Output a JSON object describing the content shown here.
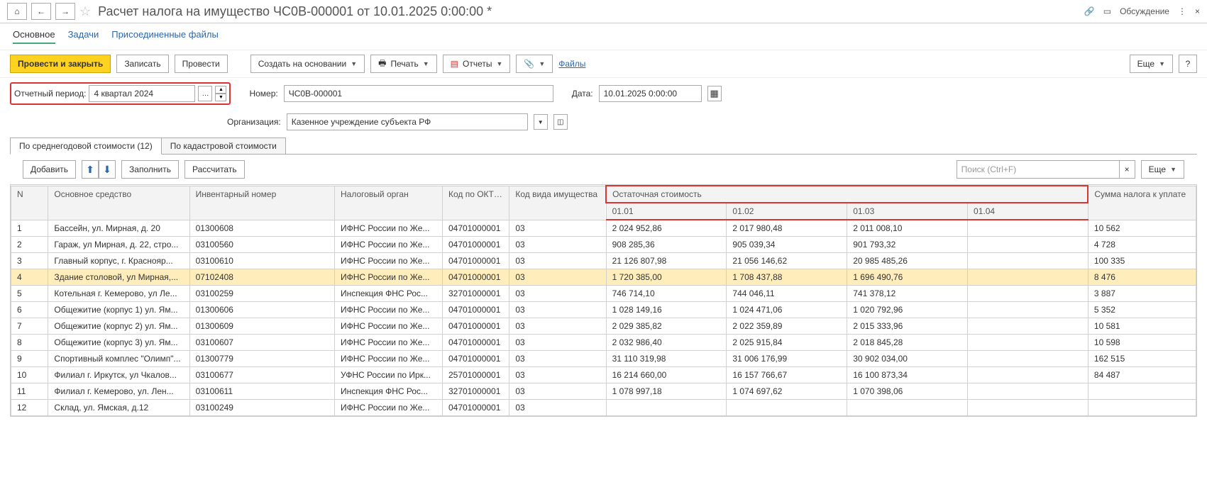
{
  "header": {
    "title": "Расчет налога на имущество ЧС0В-000001 от 10.01.2025 0:00:00 *",
    "discussion": "Обсуждение"
  },
  "nav_tabs": {
    "main": "Основное",
    "tasks": "Задачи",
    "files": "Присоединенные файлы"
  },
  "toolbar": {
    "post_close": "Провести и закрыть",
    "write": "Записать",
    "post": "Провести",
    "create_based": "Создать на основании",
    "print": "Печать",
    "reports": "Отчеты",
    "files": "Файлы",
    "more": "Еще"
  },
  "form": {
    "period_label": "Отчетный период:",
    "period_value": "4 квартал 2024",
    "number_label": "Номер:",
    "number_value": "ЧС0В-000001",
    "date_label": "Дата:",
    "date_value": "10.01.2025  0:00:00",
    "org_label": "Организация:",
    "org_value": "Казенное учреждение субъекта РФ"
  },
  "subtabs": {
    "avg": "По среднегодовой стоимости (12)",
    "cadastr": "По кадастровой стоимости"
  },
  "subtoolbar": {
    "add": "Добавить",
    "fill": "Заполнить",
    "calc": "Рассчитать",
    "search_placeholder": "Поиск (Ctrl+F)",
    "more": "Еще"
  },
  "grid": {
    "headers": {
      "n": "N",
      "asset": "Основное средство",
      "inv": "Инвентарный номер",
      "tax_org": "Налоговый орган",
      "oktmo": "Код по ОКТМО",
      "kind": "Код вида имущества",
      "residual": "Остаточная стоимость",
      "d01": "01.01",
      "d02": "01.02",
      "d03": "01.03",
      "d04": "01.04",
      "sum": "Сумма налога к уплате"
    },
    "rows": [
      {
        "n": "1",
        "asset": "Бассейн, ул. Мирная, д. 20",
        "inv": "01300608",
        "tax_org": "ИФНС России по Же...",
        "oktmo": "04701000001",
        "kind": "03",
        "v1": "2 024 952,86",
        "v2": "2 017 980,48",
        "v3": "2 011 008,10",
        "v4": "",
        "sum": "10 562"
      },
      {
        "n": "2",
        "asset": "Гараж, ул Мирная, д. 22, стро...",
        "inv": "03100560",
        "tax_org": "ИФНС России по Же...",
        "oktmo": "04701000001",
        "kind": "03",
        "v1": "908 285,36",
        "v2": "905 039,34",
        "v3": "901 793,32",
        "v4": "",
        "sum": "4 728"
      },
      {
        "n": "3",
        "asset": "Главный корпус, г. Краснояр...",
        "inv": "03100610",
        "tax_org": "ИФНС России по Же...",
        "oktmo": "04701000001",
        "kind": "03",
        "v1": "21 126 807,98",
        "v2": "21 056 146,62",
        "v3": "20 985 485,26",
        "v4": "",
        "sum": "100 335"
      },
      {
        "n": "4",
        "asset": "Здание столовой, ул Мирная,...",
        "inv": "07102408",
        "tax_org": "ИФНС России по Же...",
        "oktmo": "04701000001",
        "kind": "03",
        "v1": "1 720 385,00",
        "v2": "1 708 437,88",
        "v3": "1 696 490,76",
        "v4": "",
        "sum": "8 476",
        "selected": true
      },
      {
        "n": "5",
        "asset": "Котельная г. Кемерово, ул Ле...",
        "inv": "03100259",
        "tax_org": "Инспекция ФНС Рос...",
        "oktmo": "32701000001",
        "kind": "03",
        "v1": "746 714,10",
        "v2": "744 046,11",
        "v3": "741 378,12",
        "v4": "",
        "sum": "3 887"
      },
      {
        "n": "6",
        "asset": "Общежитие (корпус 1) ул. Ям...",
        "inv": "01300606",
        "tax_org": "ИФНС России по Же...",
        "oktmo": "04701000001",
        "kind": "03",
        "v1": "1 028 149,16",
        "v2": "1 024 471,06",
        "v3": "1 020 792,96",
        "v4": "",
        "sum": "5 352"
      },
      {
        "n": "7",
        "asset": "Общежитие (корпус 2) ул. Ям...",
        "inv": "01300609",
        "tax_org": "ИФНС России по Же...",
        "oktmo": "04701000001",
        "kind": "03",
        "v1": "2 029 385,82",
        "v2": "2 022 359,89",
        "v3": "2 015 333,96",
        "v4": "",
        "sum": "10 581"
      },
      {
        "n": "8",
        "asset": "Общежитие (корпус 3) ул. Ям...",
        "inv": "03100607",
        "tax_org": "ИФНС России по Же...",
        "oktmo": "04701000001",
        "kind": "03",
        "v1": "2 032 986,40",
        "v2": "2 025 915,84",
        "v3": "2 018 845,28",
        "v4": "",
        "sum": "10 598"
      },
      {
        "n": "9",
        "asset": "Спортивный комплес \"Олимп\"...",
        "inv": "01300779",
        "tax_org": "ИФНС России по Же...",
        "oktmo": "04701000001",
        "kind": "03",
        "v1": "31 110 319,98",
        "v2": "31 006 176,99",
        "v3": "30 902 034,00",
        "v4": "",
        "sum": "162 515"
      },
      {
        "n": "10",
        "asset": "Филиал г. Иркутск, ул Чкалов...",
        "inv": "03100677",
        "tax_org": "УФНС России по Ирк...",
        "oktmo": "25701000001",
        "kind": "03",
        "v1": "16 214 660,00",
        "v2": "16 157 766,67",
        "v3": "16 100 873,34",
        "v4": "",
        "sum": "84 487"
      },
      {
        "n": "11",
        "asset": "Филиал г. Кемерово, ул. Лен...",
        "inv": "03100611",
        "tax_org": "Инспекция ФНС Рос...",
        "oktmo": "32701000001",
        "kind": "03",
        "v1": "1 078 997,18",
        "v2": "1 074 697,62",
        "v3": "1 070 398,06",
        "v4": "",
        "sum": ""
      },
      {
        "n": "12",
        "asset": "Склад, ул. Ямская, д.12",
        "inv": "03100249",
        "tax_org": "ИФНС России по Же...",
        "oktmo": "04701000001",
        "kind": "03",
        "v1": "",
        "v2": "",
        "v3": "",
        "v4": "",
        "sum": ""
      }
    ]
  }
}
